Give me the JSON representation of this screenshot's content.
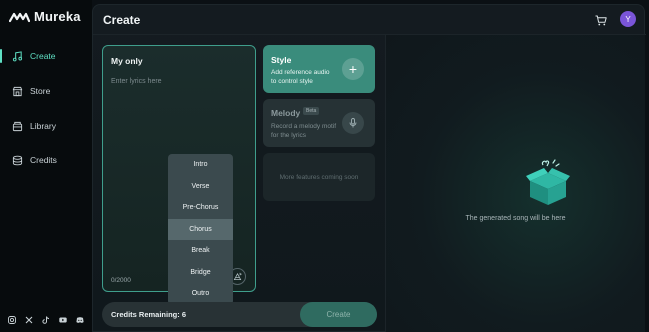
{
  "app": {
    "name": "Mureka"
  },
  "sidebar": {
    "items": [
      {
        "label": "Create",
        "icon": "music-note-icon",
        "active": true
      },
      {
        "label": "Store",
        "icon": "store-icon",
        "active": false
      },
      {
        "label": "Library",
        "icon": "library-icon",
        "active": false
      },
      {
        "label": "Credits",
        "icon": "credits-icon",
        "active": false
      }
    ],
    "socials": [
      "instagram-icon",
      "x-icon",
      "tiktok-icon",
      "youtube-icon",
      "discord-icon"
    ]
  },
  "header": {
    "title": "Create",
    "avatar_initial": "Y"
  },
  "lyrics": {
    "title": "My only",
    "placeholder": "Enter lyrics here",
    "counter": "0/2000"
  },
  "dropdown": {
    "items": [
      "Intro",
      "Verse",
      "Pre-Chorus",
      "Chorus",
      "Break",
      "Bridge",
      "Outro"
    ],
    "highlighted": "Chorus"
  },
  "style_card": {
    "title": "Style",
    "subtitle": "Add reference audio to control style"
  },
  "melody_card": {
    "title": "Melody",
    "badge": "Beta",
    "subtitle": "Record a melody motif for the lyrics"
  },
  "more_card": {
    "label": "More features coming soon"
  },
  "footer": {
    "credits_label": "Credits Remaining: 6",
    "create_label": "Create"
  },
  "result": {
    "empty_text": "The generated song will be here"
  },
  "colors": {
    "accent": "#5fe0c4",
    "style_card": "#3a8c7c",
    "avatar": "#7a55d8"
  }
}
